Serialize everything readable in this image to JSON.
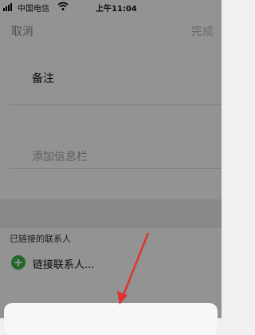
{
  "status_bar": {
    "carrier": "中国电信",
    "time": "上午11:04"
  },
  "nav": {
    "cancel_label": "取消",
    "done_label": "完成"
  },
  "fields": {
    "notes_label": "备注",
    "add_field_placeholder": "添加信息栏"
  },
  "linked_contacts": {
    "section_title": "已链接的联系人",
    "link_contact_label": "链接联系人..."
  },
  "annotation": {
    "arrow_color": "#e0312e"
  },
  "colors": {
    "add_icon": "#3cb34a"
  }
}
